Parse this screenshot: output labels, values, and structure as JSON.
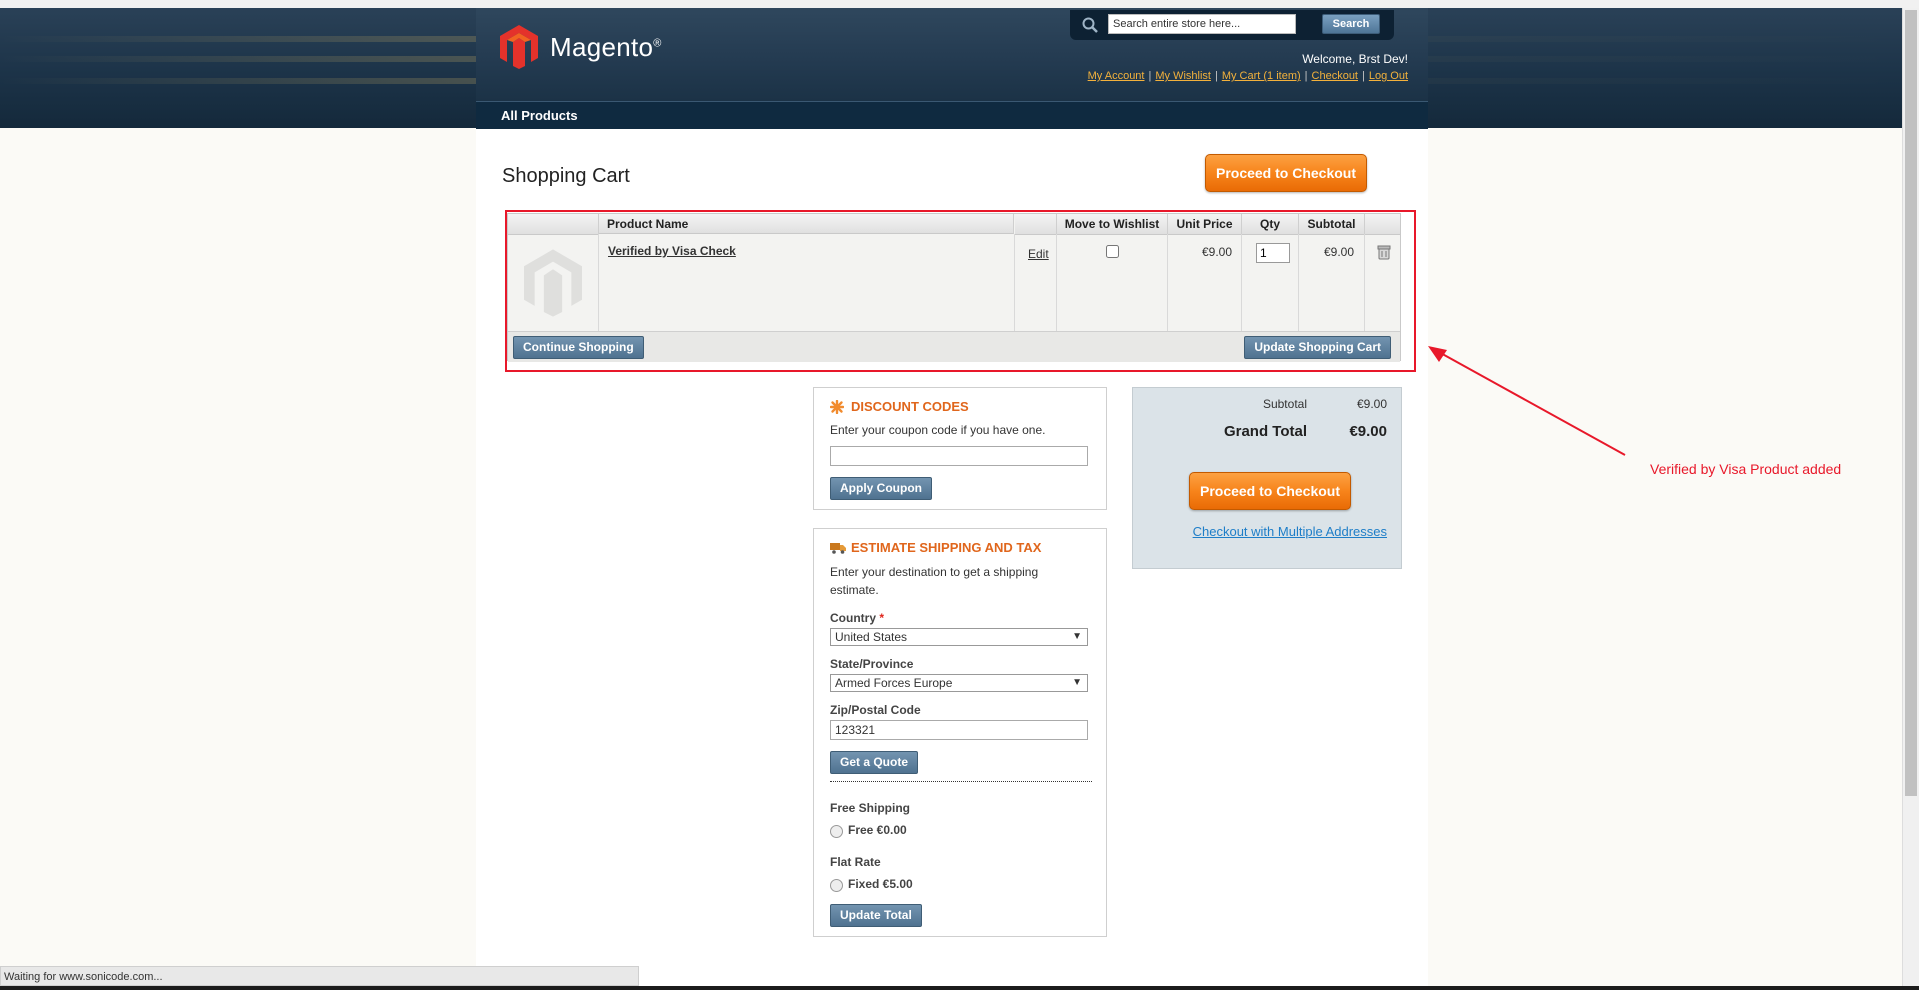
{
  "header": {
    "logo_text": "Magento",
    "logo_reg": "®",
    "search_placeholder": "Search entire store here...",
    "search_button": "Search",
    "welcome": "Welcome, Brst Dev!",
    "links": [
      "My Account",
      "My Wishlist",
      "My Cart (1 item)",
      "Checkout",
      "Log Out"
    ],
    "link_separator": "|"
  },
  "nav": {
    "all_products": "All Products"
  },
  "cart": {
    "title": "Shopping Cart",
    "proceed_to_checkout": "Proceed to Checkout",
    "columns": {
      "product_name": "Product Name",
      "move_to_wishlist": "Move to Wishlist",
      "unit_price": "Unit Price",
      "qty": "Qty",
      "subtotal": "Subtotal"
    },
    "item": {
      "name": "Verified by Visa Check",
      "edit": "Edit",
      "unit_price": "€9.00",
      "qty": "1",
      "subtotal": "€9.00"
    },
    "continue_shopping": "Continue Shopping",
    "update_cart": "Update Shopping Cart"
  },
  "annotation": {
    "text": "Verified by Visa Product added",
    "color": "#e8182a"
  },
  "discount": {
    "title": "Discount Codes",
    "prompt": "Enter your coupon code if you have one.",
    "apply": "Apply Coupon"
  },
  "shipping": {
    "title": "Estimate Shipping and Tax",
    "prompt_line1": "Enter your destination to get a shipping",
    "prompt_line2": "estimate.",
    "country_label": "Country",
    "required_mark": "*",
    "country_value": "United States",
    "state_label": "State/Province",
    "state_value": "Armed Forces Europe",
    "zip_label": "Zip/Postal Code",
    "zip_value": "123321",
    "get_quote": "Get a Quote",
    "free_shipping_label": "Free Shipping",
    "free_shipping_option": "Free €0.00",
    "flat_rate_label": "Flat Rate",
    "flat_rate_option": "Fixed €5.00",
    "update_total": "Update Total"
  },
  "totals": {
    "subtotal_label": "Subtotal",
    "subtotal_value": "€9.00",
    "grand_total_label": "Grand Total",
    "grand_total_value": "€9.00",
    "proceed_to_checkout": "Proceed to Checkout",
    "multi_address": "Checkout with Multiple Addresses"
  },
  "status": {
    "text": "Waiting for www.sonicode.com..."
  },
  "colors": {
    "accent_orange": "#f7841b",
    "header_navy": "#1c3348",
    "link_blue": "#1e7ec8",
    "section_title": "#e0661c"
  }
}
